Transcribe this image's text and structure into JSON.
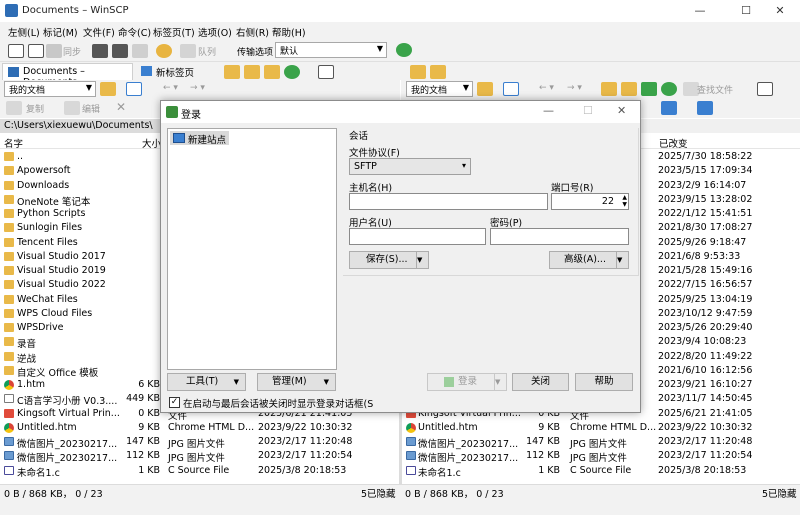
{
  "window": {
    "title": "Documents – WinSCP",
    "minimize": "—",
    "maximize": "☐",
    "close": "✕"
  },
  "menu": [
    "左侧(L)",
    "标记(M)",
    "文件(F)",
    "命令(C)",
    "标签页(T)",
    "选项(O)",
    "右侧(R)",
    "帮助(H)"
  ],
  "toolbar": {
    "sync_label": "同步",
    "queue_label": "队列",
    "transfer_label": "传输选项",
    "transfer_value": "默认"
  },
  "tabs": {
    "active": "Documents – Documents",
    "new_tab": "新标签页"
  },
  "left_nav": {
    "location": "我的文档",
    "copy_label": "复制",
    "edit_label": "编辑"
  },
  "right_nav": {
    "location": "我的文档",
    "find_label": "查找文件"
  },
  "left_path": "C:\\Users\\xiexuewu\\Documents\\",
  "left_headers": {
    "name": "名字",
    "size": "大小"
  },
  "right_headers": {
    "modified": "已改变"
  },
  "left_files": [
    {
      "name": "..",
      "type": "folder-up",
      "size": "",
      "kind": "",
      "date": ""
    },
    {
      "name": "Apowersoft",
      "type": "folder",
      "size": "",
      "kind": "",
      "date": ""
    },
    {
      "name": "Downloads",
      "type": "folder",
      "size": "",
      "kind": "",
      "date": ""
    },
    {
      "name": "OneNote 笔记本",
      "type": "folder",
      "size": "",
      "kind": "",
      "date": ""
    },
    {
      "name": "Python Scripts",
      "type": "folder",
      "size": "",
      "kind": "",
      "date": ""
    },
    {
      "name": "Sunlogin Files",
      "type": "folder",
      "size": "",
      "kind": "",
      "date": ""
    },
    {
      "name": "Tencent Files",
      "type": "folder",
      "size": "",
      "kind": "",
      "date": ""
    },
    {
      "name": "Visual Studio 2017",
      "type": "folder",
      "size": "",
      "kind": "",
      "date": ""
    },
    {
      "name": "Visual Studio 2019",
      "type": "folder",
      "size": "",
      "kind": "",
      "date": ""
    },
    {
      "name": "Visual Studio 2022",
      "type": "folder",
      "size": "",
      "kind": "",
      "date": ""
    },
    {
      "name": "WeChat Files",
      "type": "folder",
      "size": "",
      "kind": "",
      "date": ""
    },
    {
      "name": "WPS Cloud Files",
      "type": "folder",
      "size": "",
      "kind": "",
      "date": ""
    },
    {
      "name": "WPSDrive",
      "type": "folder",
      "size": "",
      "kind": "",
      "date": ""
    },
    {
      "name": "录音",
      "type": "folder",
      "size": "",
      "kind": "",
      "date": ""
    },
    {
      "name": "逆战",
      "type": "folder",
      "size": "",
      "kind": "",
      "date": ""
    },
    {
      "name": "自定义 Office 模板",
      "type": "folder",
      "size": "",
      "kind": "",
      "date": ""
    },
    {
      "name": "1.htm",
      "type": "chrome",
      "size": "6 KB",
      "kind": "",
      "date": ""
    },
    {
      "name": "C语言学习小册 V0.3....",
      "type": "doc",
      "size": "449 KB",
      "kind": "",
      "date": ""
    },
    {
      "name": "Kingsoft Virtual Prin...",
      "type": "ksoft",
      "size": "0 KB",
      "kind": "文件",
      "date": "2025/6/21 21:41:05"
    },
    {
      "name": "Untitled.htm",
      "type": "chrome",
      "size": "9 KB",
      "kind": "Chrome HTML D...",
      "date": "2023/9/22 10:30:32"
    },
    {
      "name": "微信图片_20230217...",
      "type": "jpg",
      "size": "147 KB",
      "kind": "JPG 图片文件",
      "date": "2023/2/17 11:20:48"
    },
    {
      "name": "微信图片_20230217...",
      "type": "jpg",
      "size": "112 KB",
      "kind": "JPG 图片文件",
      "date": "2023/2/17 11:20:54"
    },
    {
      "name": "未命名1.c",
      "type": "cfile",
      "size": "1 KB",
      "kind": "C Source File",
      "date": "2025/3/8 20:18:53"
    }
  ],
  "right_dates": [
    "2025/7/30 18:58:22",
    "2023/5/15 17:09:34",
    "2023/2/9 16:14:07",
    "2023/9/15 13:28:02",
    "2022/1/12 15:41:51",
    "2021/8/30 17:08:27",
    "2025/9/26 9:18:47",
    "2021/6/8 9:53:33",
    "2021/5/28 15:49:16",
    "2022/7/15 16:56:57",
    "2025/9/25 13:04:19",
    "2023/10/12 9:47:59",
    "2023/5/26 20:29:40",
    "2023/9/4 10:08:23",
    "2022/8/20 11:49:22",
    "2021/6/10 16:12:56",
    "2023/9/21 16:10:27",
    "2023/11/7 14:50:45"
  ],
  "right_files_bottom": [
    {
      "name": "Kingsoft Virtual Prin...",
      "type": "ksoft",
      "size": "0 KB",
      "kind": "文件",
      "date": "2025/6/21 21:41:05"
    },
    {
      "name": "Untitled.htm",
      "type": "chrome",
      "size": "9 KB",
      "kind": "Chrome HTML D...",
      "date": "2023/9/22 10:30:32"
    },
    {
      "name": "微信图片_20230217...",
      "type": "jpg",
      "size": "147 KB",
      "kind": "JPG 图片文件",
      "date": "2023/2/17 11:20:48"
    },
    {
      "name": "微信图片_20230217...",
      "type": "jpg",
      "size": "112 KB",
      "kind": "JPG 图片文件",
      "date": "2023/2/17 11:20:54"
    },
    {
      "name": "未命名1.c",
      "type": "cfile",
      "size": "1 KB",
      "kind": "C Source File",
      "date": "2025/3/8 20:18:53"
    }
  ],
  "status": {
    "left": "0 B / 868 KB，  0 / 23",
    "left_hidden": "5已隐藏",
    "right": "0 B / 868 KB，  0 / 23",
    "right_hidden": "5已隐藏"
  },
  "dialog": {
    "title": "登录",
    "tree_item": "新建站点",
    "session_group": "会话",
    "protocol_label": "文件协议(F)",
    "protocol_value": "SFTP",
    "host_label": "主机名(H)",
    "host_value": "",
    "port_label": "端口号(R)",
    "port_value": "22",
    "user_label": "用户名(U)",
    "user_value": "",
    "password_label": "密码(P)",
    "password_value": "",
    "save_button": "保存(S)...",
    "advanced_button": "高级(A)...",
    "tools_button": "工具(T)",
    "manage_button": "管理(M)",
    "login_button": "登录",
    "close_button": "关闭",
    "help_button": "帮助",
    "startup_checkbox": "在启动与最后会话被关闭时显示登录对话框(S",
    "startup_checked": true
  }
}
